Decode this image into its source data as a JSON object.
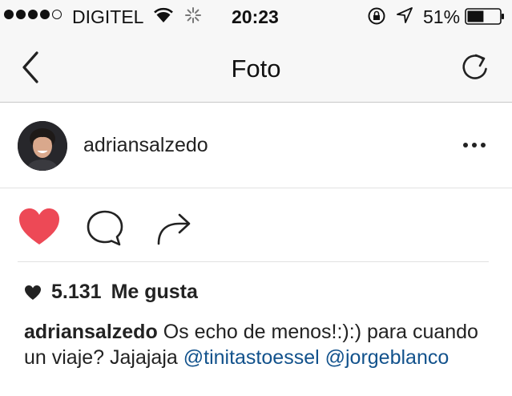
{
  "status_bar": {
    "carrier": "DIGITEL",
    "time": "20:23",
    "battery_percent": "51%",
    "battery_level": 0.51,
    "signal_bars_filled": 4,
    "signal_bars_total": 5
  },
  "nav": {
    "title": "Foto",
    "back_icon": "chevron-left-icon",
    "refresh_icon": "refresh-icon"
  },
  "post": {
    "username": "adriansalzedo",
    "more_icon": "ellipsis-icon",
    "likes_count": "5.131",
    "likes_label": "Me gusta",
    "liked": true,
    "like_color": "#ed4956",
    "caption": {
      "user": "adriansalzedo",
      "text": "Os echo de menos!:):) para cuando un viaje? Jajajaja",
      "mention_1": "@tinitastoessel",
      "mention_2": "@jorgeblanco"
    }
  },
  "colors": {
    "bar_background": "#f7f7f7",
    "mention": "#12528c",
    "like_heart": "#ed4956"
  }
}
